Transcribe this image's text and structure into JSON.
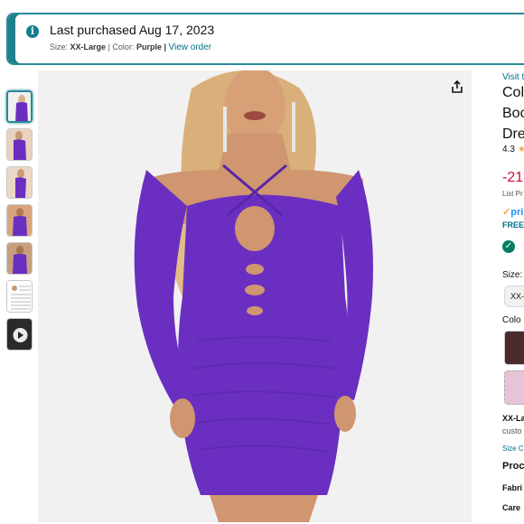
{
  "alert": {
    "title": "Last purchased Aug 17, 2023",
    "size_label": "Size:",
    "size_value": "XX-Large",
    "color_label": "Color:",
    "color_value": "Purple",
    "link": "View order"
  },
  "thumbnails": [
    "image-1",
    "image-2",
    "image-3",
    "image-4",
    "image-5",
    "size-chart",
    "video"
  ],
  "side": {
    "visit": "Visit t",
    "title_line1": "Col",
    "title_line2": "Boc",
    "title_line3": "Dre",
    "rating": "4.3",
    "discount": "-21",
    "list_price": "List Pr",
    "prime": "prin",
    "free": "FREE",
    "size_label": "Size:",
    "size_value": "XX-",
    "color_label": "Colo",
    "selected": "XX-La",
    "custom": "custo",
    "size_chart": "Size Cl",
    "product": "Proc",
    "fabric": "Fabri",
    "care": "Care"
  },
  "colors": {
    "accent": "#2b8a96",
    "dress": "#6a2fc1",
    "link": "#007185",
    "discount": "#cc0c39"
  }
}
